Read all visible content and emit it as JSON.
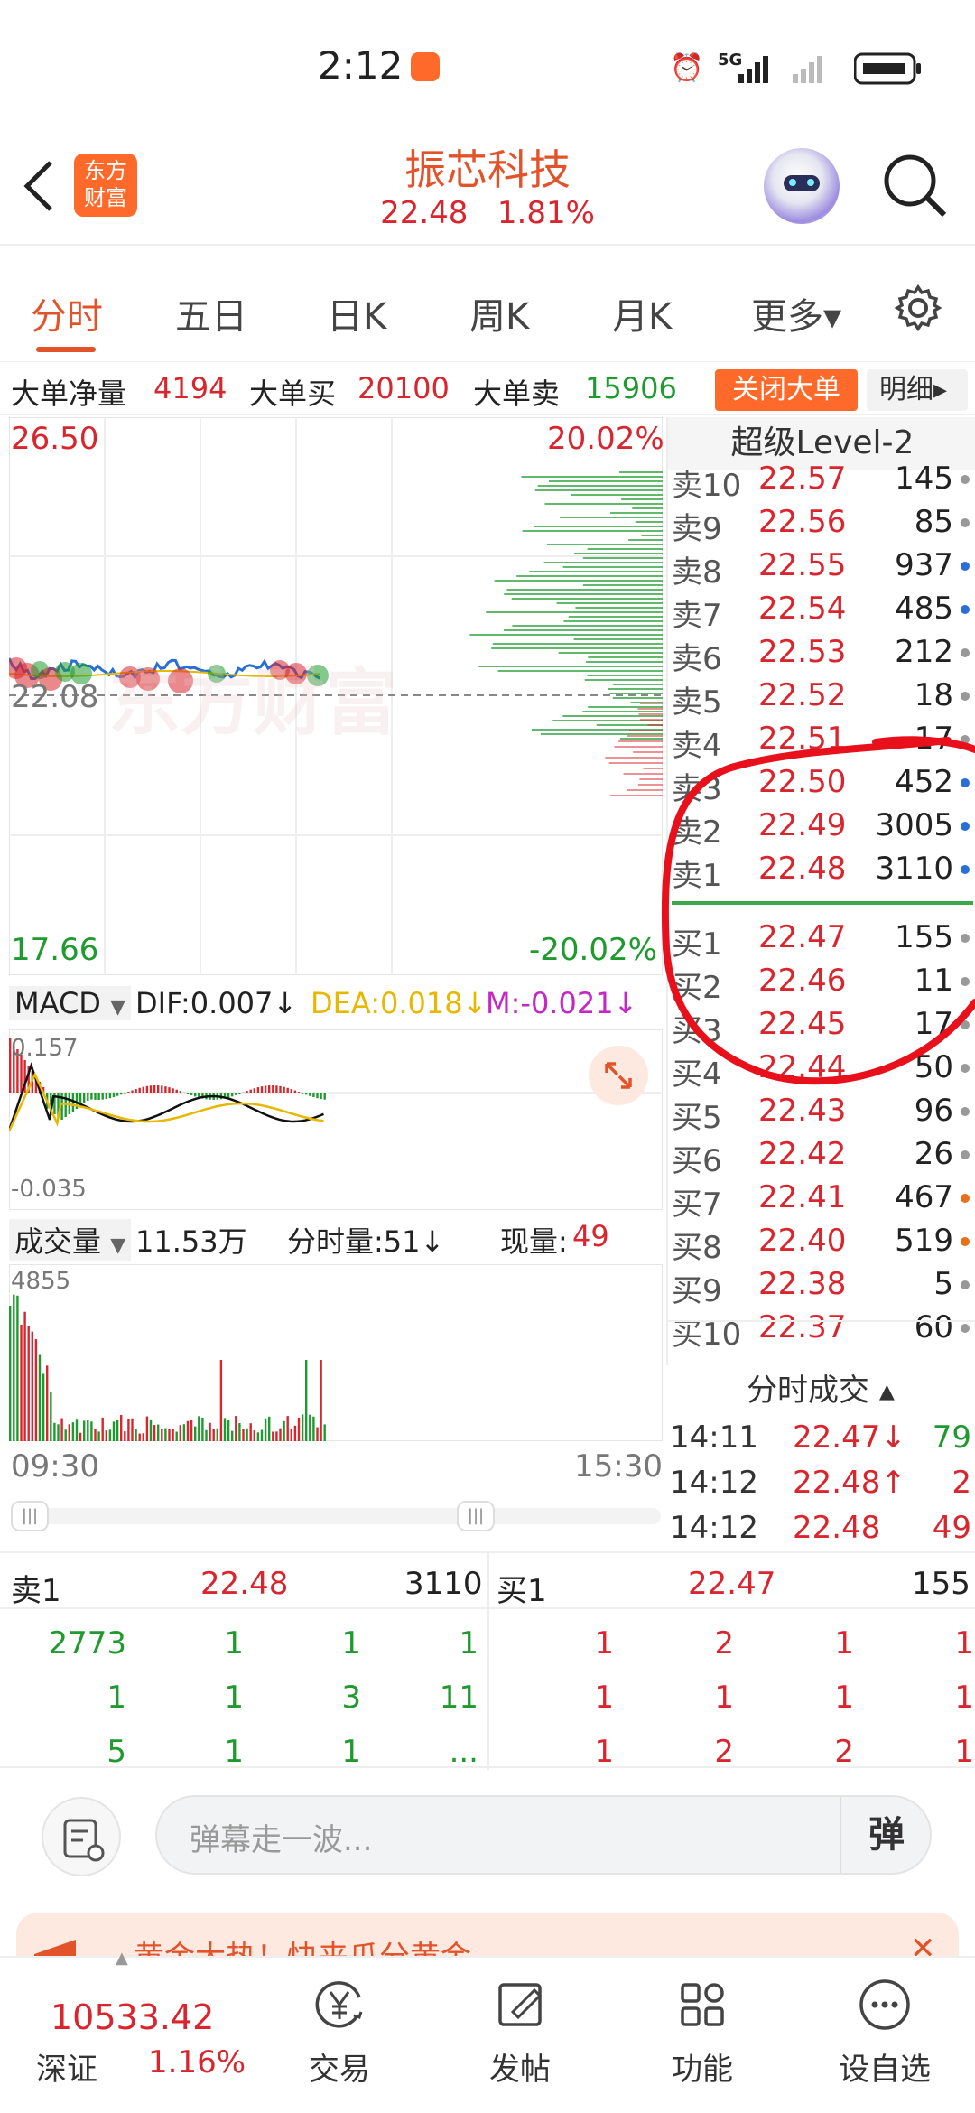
{
  "status_bar": {
    "time": "2:12",
    "network": "5G"
  },
  "header": {
    "back_icon": "chevron-left-icon",
    "logo_text": "东方财富",
    "stock_name": "振芯科技",
    "price": "22.48",
    "change_pct": "1.81%"
  },
  "tabs": [
    {
      "label": "分时",
      "active": true
    },
    {
      "label": "五日"
    },
    {
      "label": "日K"
    },
    {
      "label": "周K"
    },
    {
      "label": "月K"
    },
    {
      "label": "更多▾"
    }
  ],
  "big_order": {
    "net_label": "大单净量",
    "net_value": "4194",
    "buy_label": "大单买",
    "buy_value": "20100",
    "sell_label": "大单卖",
    "sell_value": "15906",
    "close_button": "关闭大单",
    "detail_button": "明细▸"
  },
  "price_chart": {
    "max_price": "26.50",
    "max_pct": "20.02%",
    "min_price": "17.66",
    "min_pct": "-20.02%",
    "pre_close": "22.08",
    "watermark": "东方财富"
  },
  "macd": {
    "selector": "MACD",
    "dif": "DIF:0.007↓",
    "dea": "DEA:0.018↓",
    "m": "M:-0.021↓",
    "top_value": "0.157",
    "bottom_value": "-0.035"
  },
  "volume": {
    "selector": "成交量",
    "total": "11.53万",
    "minute_vol": "分时量:51↓",
    "current_label": "现量:",
    "current_value": "49",
    "max_value": "4855",
    "start_time": "09:30",
    "end_time": "15:30"
  },
  "orderbook": {
    "title": "超级Level-2",
    "asks": [
      {
        "label": "卖10",
        "price": "22.57",
        "vol": "145",
        "dot": "#999999"
      },
      {
        "label": "卖9",
        "price": "22.56",
        "vol": "85",
        "dot": "#999999"
      },
      {
        "label": "卖8",
        "price": "22.55",
        "vol": "937",
        "dot": "#2a6fd6"
      },
      {
        "label": "卖7",
        "price": "22.54",
        "vol": "485",
        "dot": "#2a6fd6"
      },
      {
        "label": "卖6",
        "price": "22.53",
        "vol": "212",
        "dot": "#999999"
      },
      {
        "label": "卖5",
        "price": "22.52",
        "vol": "18",
        "dot": "#999999"
      },
      {
        "label": "卖4",
        "price": "22.51",
        "vol": "17",
        "dot": "#999999"
      },
      {
        "label": "卖3",
        "price": "22.50",
        "vol": "452",
        "dot": "#2a6fd6"
      },
      {
        "label": "卖2",
        "price": "22.49",
        "vol": "3005",
        "dot": "#2a6fd6"
      },
      {
        "label": "卖1",
        "price": "22.48",
        "vol": "3110",
        "dot": "#2a6fd6"
      }
    ],
    "bids": [
      {
        "label": "买1",
        "price": "22.47",
        "vol": "155",
        "dot": "#999999"
      },
      {
        "label": "买2",
        "price": "22.46",
        "vol": "11",
        "dot": "#999999"
      },
      {
        "label": "买3",
        "price": "22.45",
        "vol": "17",
        "dot": "#999999"
      },
      {
        "label": "买4",
        "price": "22.44",
        "vol": "50",
        "dot": "#999999"
      },
      {
        "label": "买5",
        "price": "22.43",
        "vol": "96",
        "dot": "#999999"
      },
      {
        "label": "买6",
        "price": "22.42",
        "vol": "26",
        "dot": "#999999"
      },
      {
        "label": "买7",
        "price": "22.41",
        "vol": "467",
        "dot": "#e8701a"
      },
      {
        "label": "买8",
        "price": "22.40",
        "vol": "519",
        "dot": "#e8701a"
      },
      {
        "label": "买9",
        "price": "22.38",
        "vol": "5",
        "dot": "#999999"
      },
      {
        "label": "买10",
        "price": "22.37",
        "vol": "60",
        "dot": "#999999"
      }
    ],
    "ticks_title": "分时成交 ▴",
    "ticks": [
      {
        "time": "14:11",
        "price": "22.47↓",
        "vol": "79",
        "color": "#1f9a2e"
      },
      {
        "time": "14:12",
        "price": "22.48↑",
        "vol": "2",
        "color": "#d9262e"
      },
      {
        "time": "14:12",
        "price": "22.48",
        "vol": "49",
        "color": "#d9262e"
      }
    ]
  },
  "queue": {
    "sell_label": "卖1",
    "sell_price": "22.48",
    "sell_vol": "3110",
    "buy_label": "买1",
    "buy_price": "22.47",
    "buy_vol": "155",
    "sell_rows": [
      [
        "2773",
        "1",
        "1",
        "1"
      ],
      [
        "1",
        "1",
        "3",
        "11"
      ],
      [
        "5",
        "1",
        "1",
        "..."
      ]
    ],
    "buy_rows": [
      [
        "1",
        "2",
        "1",
        "1"
      ],
      [
        "1",
        "1",
        "1",
        "1"
      ],
      [
        "1",
        "2",
        "2",
        "1"
      ]
    ]
  },
  "comment": {
    "placeholder": "弹幕走一波...",
    "danmu_button": "弹"
  },
  "banner": {
    "text": "黄金大热！快来瓜分黄金"
  },
  "bottom_nav": {
    "index_value": "10533.42",
    "index_name": "深证",
    "index_pct": "1.16%",
    "items": [
      {
        "label": "交易",
        "icon": "yen-icon"
      },
      {
        "label": "发帖",
        "icon": "edit-icon"
      },
      {
        "label": "功能",
        "icon": "grid-icon"
      },
      {
        "label": "设自选",
        "icon": "more-icon"
      }
    ]
  },
  "colors": {
    "up": "#d9262e",
    "down": "#1f9a2e",
    "accent": "#e2532a",
    "annotation": "#e8101a"
  }
}
